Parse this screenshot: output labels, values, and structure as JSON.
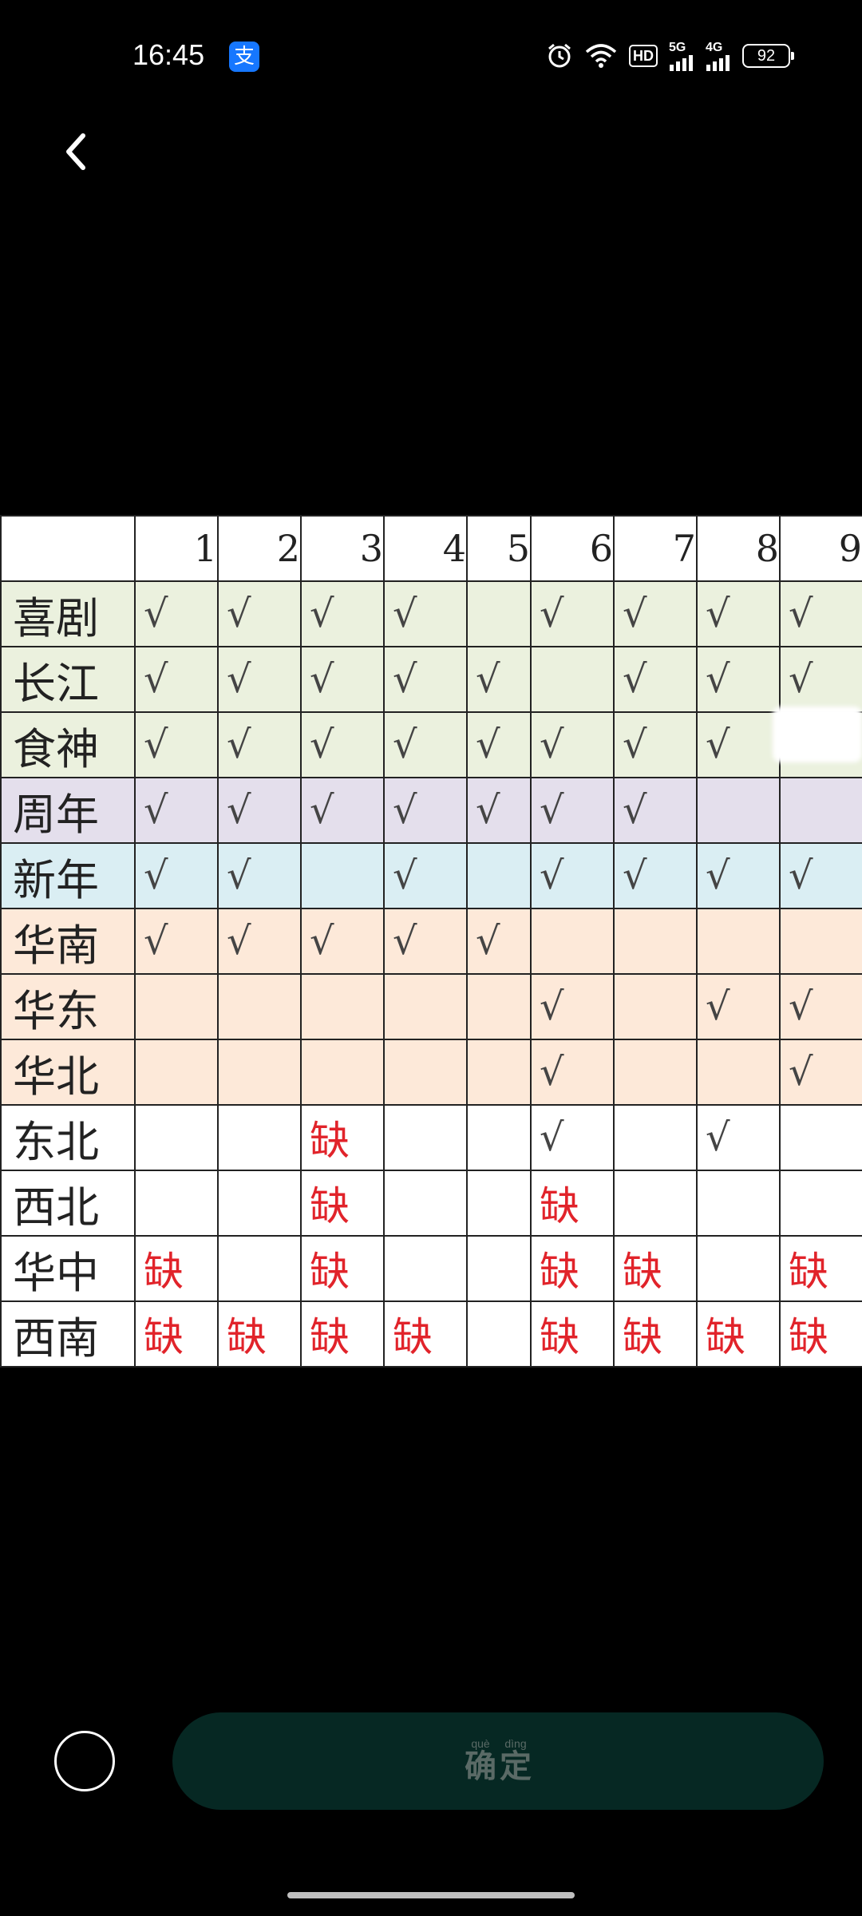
{
  "status": {
    "time": "16:45",
    "app_badge": "支",
    "hd": "HD",
    "net1": "5G",
    "net2": "4G",
    "battery": "92"
  },
  "grid": {
    "columns": [
      "1",
      "2",
      "3",
      "4",
      "5",
      "6",
      "7",
      "8",
      "9"
    ],
    "rows": [
      {
        "label": "喜剧",
        "color": "g",
        "cells": [
          "√",
          "√",
          "√",
          "√",
          "",
          "√",
          "√",
          "√",
          "√"
        ]
      },
      {
        "label": "长江",
        "color": "g",
        "cells": [
          "√",
          "√",
          "√",
          "√",
          "√",
          "",
          "√",
          "√",
          "√"
        ]
      },
      {
        "label": "食神",
        "color": "g",
        "cells": [
          "√",
          "√",
          "√",
          "√",
          "√",
          "√",
          "√",
          "√",
          ""
        ]
      },
      {
        "label": "周年",
        "color": "p",
        "cells": [
          "√",
          "√",
          "√",
          "√",
          "√",
          "√",
          "√",
          "",
          ""
        ]
      },
      {
        "label": "新年",
        "color": "b",
        "cells": [
          "√",
          "√",
          "",
          "√",
          "",
          "√",
          "√",
          "√",
          "√"
        ]
      },
      {
        "label": "华南",
        "color": "o",
        "cells": [
          "√",
          "√",
          "√",
          "√",
          "√",
          "",
          "",
          "",
          ""
        ]
      },
      {
        "label": "华东",
        "color": "o",
        "cells": [
          "",
          "",
          "",
          "",
          "",
          "√",
          "",
          "√",
          "√"
        ]
      },
      {
        "label": "华北",
        "color": "o",
        "cells": [
          "",
          "",
          "",
          "",
          "",
          "√",
          "",
          "",
          "√"
        ]
      },
      {
        "label": "东北",
        "color": "w",
        "cells": [
          "",
          "",
          "缺",
          "",
          "",
          "√",
          "",
          "√",
          ""
        ]
      },
      {
        "label": "西北",
        "color": "w",
        "cells": [
          "",
          "",
          "缺",
          "",
          "",
          "缺",
          "",
          "",
          ""
        ]
      },
      {
        "label": "华中",
        "color": "w",
        "cells": [
          "缺",
          "",
          "缺",
          "",
          "",
          "缺",
          "缺",
          "",
          "缺"
        ]
      },
      {
        "label": "西南",
        "color": "w",
        "cells": [
          "缺",
          "缺",
          "缺",
          "缺",
          "",
          "缺",
          "缺",
          "缺",
          "缺"
        ]
      }
    ]
  },
  "confirm": {
    "chars": [
      {
        "pinyin": "què",
        "hanzi": "确"
      },
      {
        "pinyin": "dìng",
        "hanzi": "定"
      }
    ]
  },
  "colors": {
    "check_color": "#444444",
    "missing_color": "#e1232a",
    "confirm_bg": "#062823"
  }
}
